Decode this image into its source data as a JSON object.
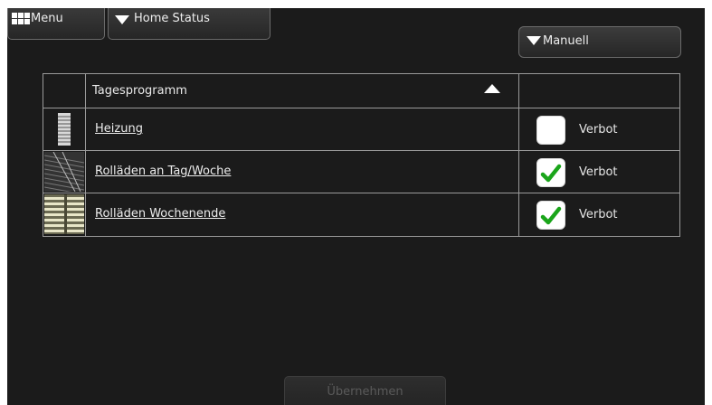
{
  "topbar": {
    "menu_label": "Menu",
    "home_status_label": "Home Status"
  },
  "mode_select": {
    "selected": "Manuell"
  },
  "table": {
    "header": "Tagesprogramm",
    "rows": [
      {
        "label": "Heizung",
        "icon": "radiator-icon",
        "checked": false,
        "status_label": "Verbot"
      },
      {
        "label": "Rolläden an Tag/Woche",
        "icon": "blinds-icon",
        "checked": true,
        "status_label": "Verbot"
      },
      {
        "label": "Rolläden Wochenende",
        "icon": "shutter-photo-icon",
        "checked": true,
        "status_label": "Verbot"
      }
    ]
  },
  "footer": {
    "apply_label": "Übernehmen"
  },
  "colors": {
    "background": "#1b1b1b",
    "checkmark": "#1aa51a",
    "border": "#9a9a9a"
  }
}
